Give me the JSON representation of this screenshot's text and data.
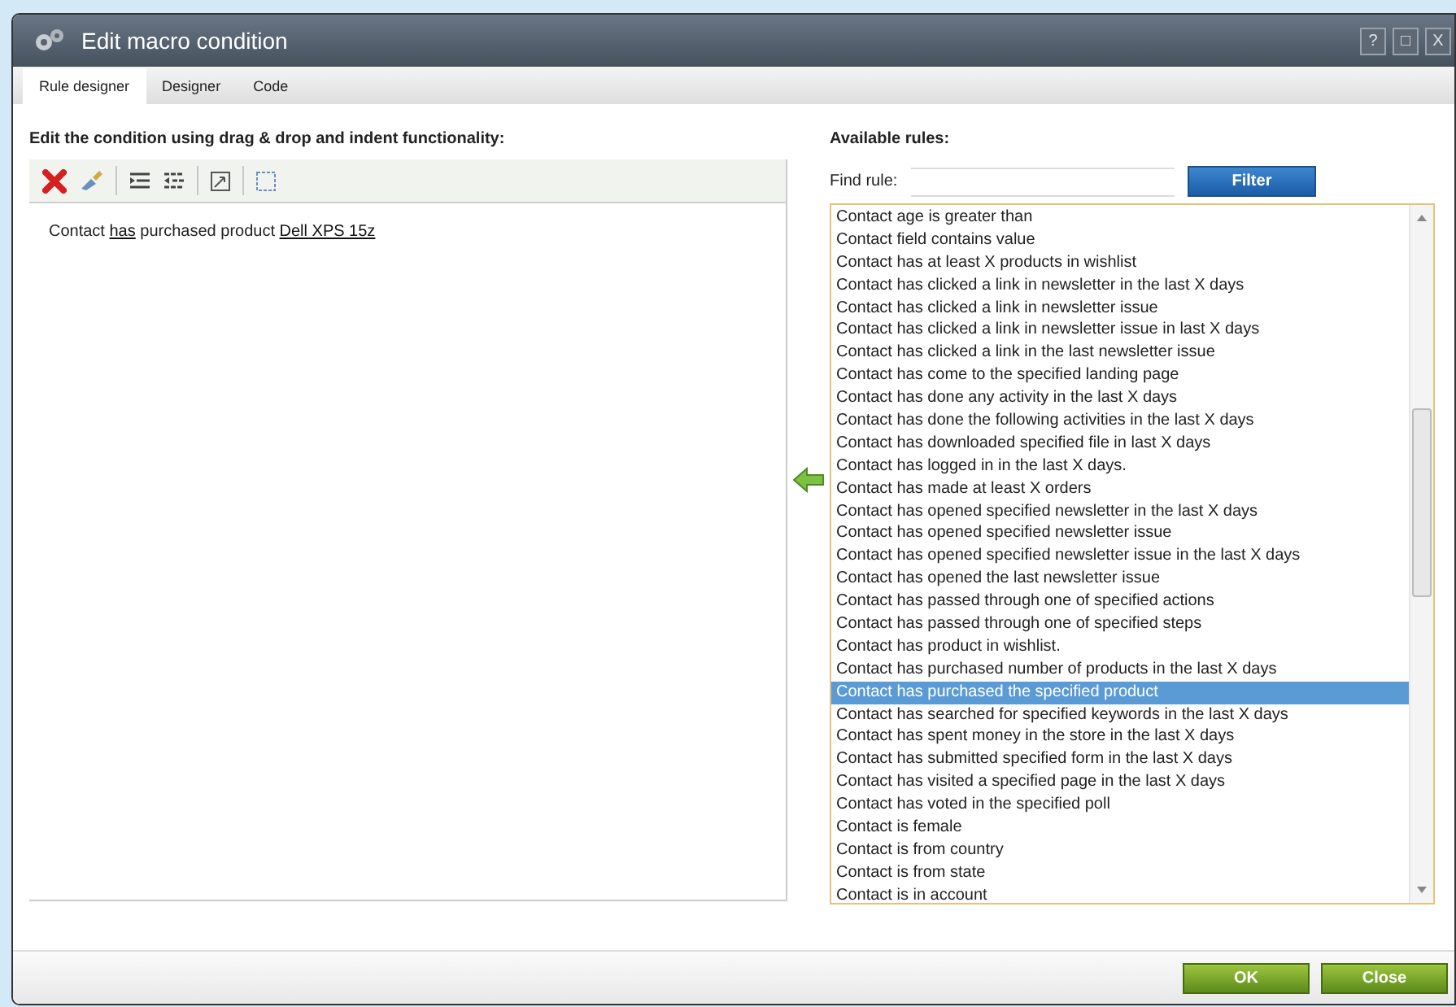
{
  "window": {
    "title": "Edit macro condition",
    "controls": [
      "?",
      "□",
      "X"
    ]
  },
  "tabs": [
    {
      "label": "Rule designer",
      "selected": true
    },
    {
      "label": "Designer",
      "selected": false
    },
    {
      "label": "Code",
      "selected": false
    }
  ],
  "editor": {
    "heading": "Edit the condition using drag & drop and indent functionality:",
    "condition": {
      "prefix": "Contact",
      "link": "has",
      "middle": "purchased product",
      "value": "Dell XPS 15z"
    }
  },
  "rules": {
    "heading": "Available rules:",
    "find_label": "Find rule:",
    "filter_button": "Filter",
    "items": [
      {
        "label": "Contact age is greater than",
        "selected": false
      },
      {
        "label": "Contact field contains value",
        "selected": false
      },
      {
        "label": "Contact has at least X products in wishlist",
        "selected": false
      },
      {
        "label": "Contact has clicked a link in newsletter in the last X days",
        "selected": false
      },
      {
        "label": "Contact has clicked a link in newsletter issue",
        "selected": false
      },
      {
        "label": "Contact has clicked a link in newsletter issue in last X days",
        "selected": false
      },
      {
        "label": "Contact has clicked a link in the last newsletter issue",
        "selected": false
      },
      {
        "label": "Contact has come to the specified landing page",
        "selected": false
      },
      {
        "label": "Contact has done any activity in the last X days",
        "selected": false
      },
      {
        "label": "Contact has done the following activities in the last X days",
        "selected": false
      },
      {
        "label": "Contact has downloaded specified file in last X days",
        "selected": false
      },
      {
        "label": "Contact has logged in in the last X days.",
        "selected": false
      },
      {
        "label": "Contact has made at least X orders",
        "selected": false
      },
      {
        "label": "Contact has opened specified newsletter in the last X days",
        "selected": false
      },
      {
        "label": "Contact has opened specified newsletter issue",
        "selected": false
      },
      {
        "label": "Contact has opened specified newsletter issue in the last X days",
        "selected": false
      },
      {
        "label": "Contact has opened the last newsletter issue",
        "selected": false
      },
      {
        "label": "Contact has passed through one of specified actions",
        "selected": false
      },
      {
        "label": "Contact has passed through one of specified steps",
        "selected": false
      },
      {
        "label": "Contact has product in wishlist.",
        "selected": false
      },
      {
        "label": "Contact has purchased number of products in the last X days",
        "selected": false
      },
      {
        "label": "Contact has purchased the specified product",
        "selected": true
      },
      {
        "label": "Contact has searched for specified keywords in the last X days",
        "selected": false
      },
      {
        "label": "Contact has spent money in the store in the last X days",
        "selected": false
      },
      {
        "label": "Contact has submitted specified form in the last X days",
        "selected": false
      },
      {
        "label": "Contact has visited a specified page in the last X days",
        "selected": false
      },
      {
        "label": "Contact has voted in the specified poll",
        "selected": false
      },
      {
        "label": "Contact is female",
        "selected": false
      },
      {
        "label": "Contact is from country",
        "selected": false
      },
      {
        "label": "Contact is from state",
        "selected": false
      },
      {
        "label": "Contact is in account",
        "selected": false
      }
    ]
  },
  "buttons": [
    "OK",
    "Close"
  ]
}
